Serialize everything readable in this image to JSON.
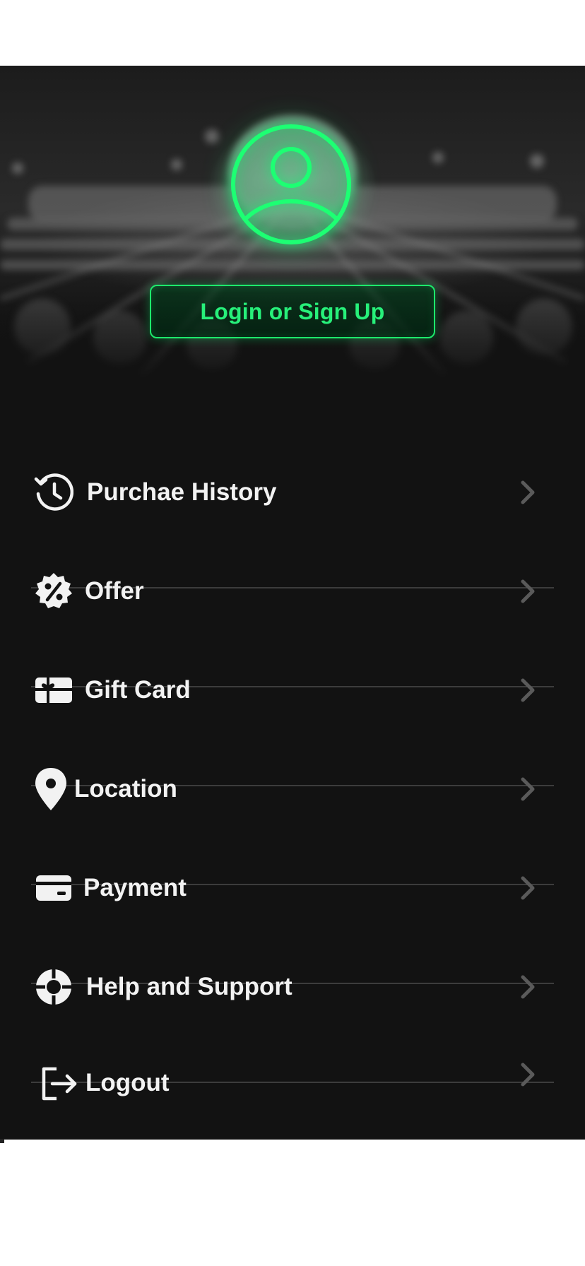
{
  "header": {
    "login_label": "Login or Sign Up"
  },
  "colors": {
    "accent": "#1de96b",
    "panel": "#121212",
    "text": "#f2f2f2",
    "divider": "#3c3c3c",
    "chevron": "#5a5a5a"
  },
  "menu": {
    "items": [
      {
        "label": "Purchae History",
        "icon": "clock-history-icon"
      },
      {
        "label": "Offer",
        "icon": "discount-badge-icon"
      },
      {
        "label": "Gift Card",
        "icon": "gift-card-icon"
      },
      {
        "label": "Location",
        "icon": "location-pin-icon"
      },
      {
        "label": "Payment",
        "icon": "credit-card-icon"
      },
      {
        "label": "Help and Support",
        "icon": "lifebuoy-icon"
      },
      {
        "label": "Logout",
        "icon": "logout-icon"
      }
    ]
  }
}
